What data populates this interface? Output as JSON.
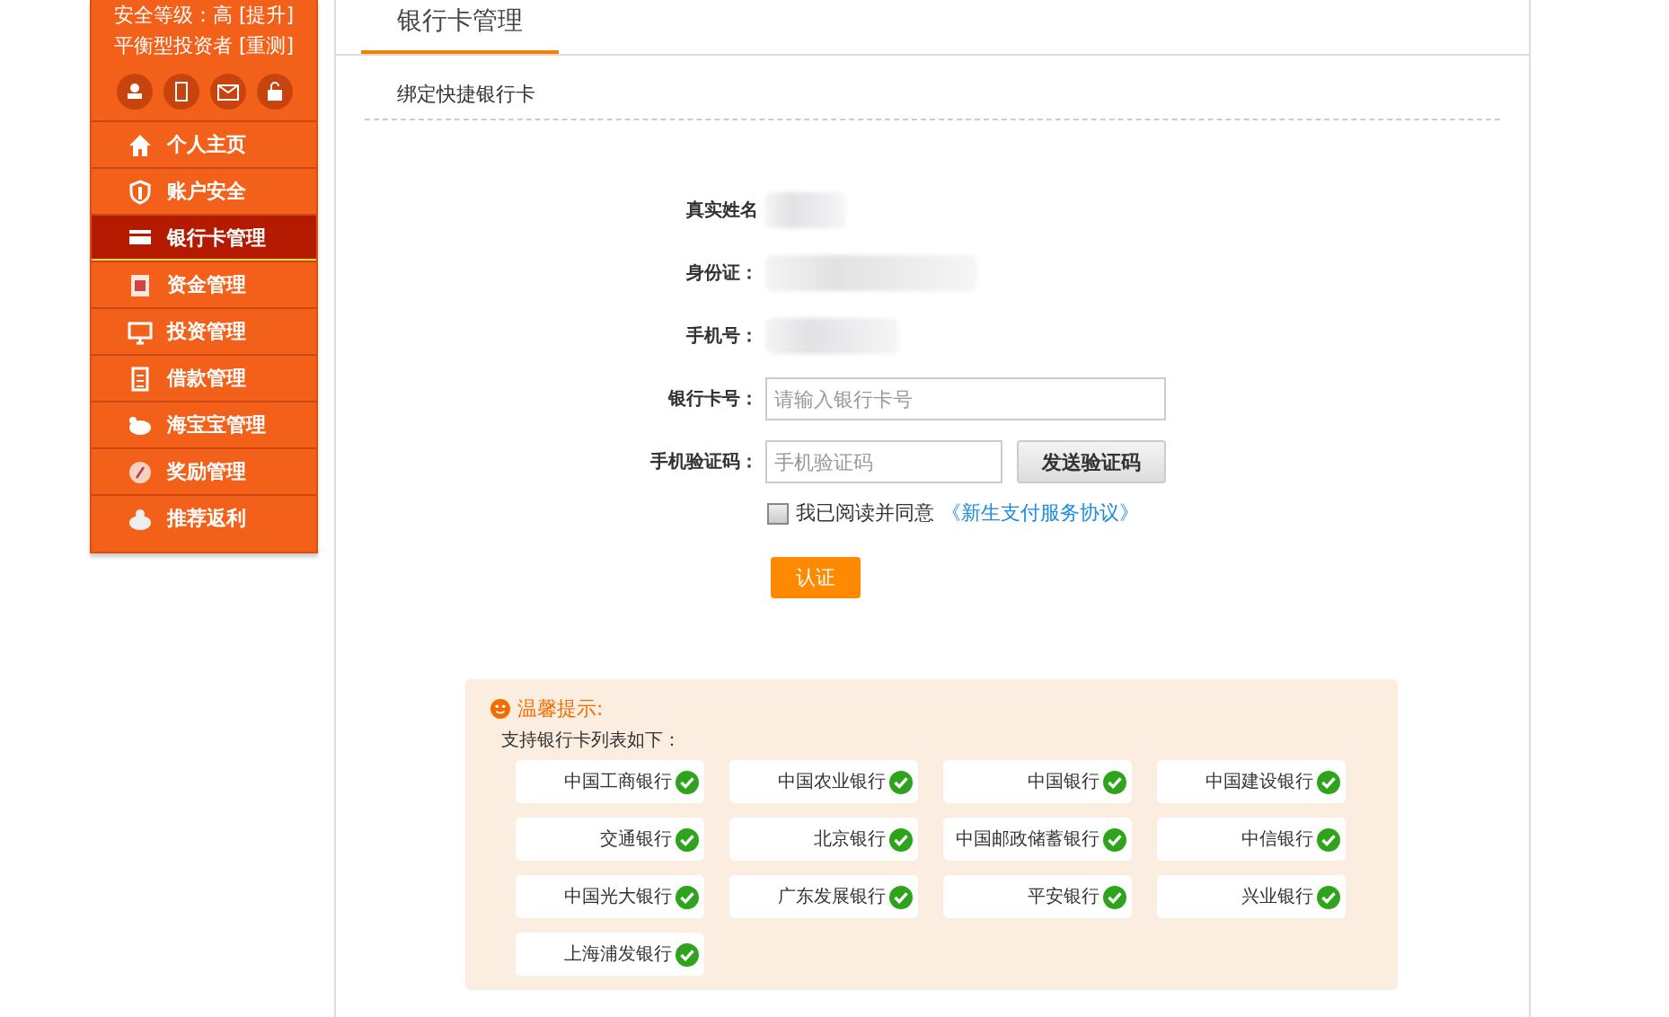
{
  "sidebar": {
    "security_level": "安全等级：高 [提升]",
    "investor_type": "平衡型投资者 [重测]",
    "items": [
      {
        "label": "个人主页",
        "selected": false
      },
      {
        "label": "账户安全",
        "selected": false
      },
      {
        "label": "银行卡管理",
        "selected": true
      },
      {
        "label": "资金管理",
        "selected": false
      },
      {
        "label": "投资管理",
        "selected": false
      },
      {
        "label": "借款管理",
        "selected": false
      },
      {
        "label": "海宝宝管理",
        "selected": false
      },
      {
        "label": "奖励管理",
        "selected": false
      },
      {
        "label": "推荐返利",
        "selected": false
      }
    ]
  },
  "tabs": [
    {
      "label": "银行卡管理",
      "selected": true
    }
  ],
  "section_title": "绑定快捷银行卡",
  "form": {
    "fields": [
      {
        "kind": "static",
        "label": "真实姓名"
      },
      {
        "kind": "static",
        "label": "身份证："
      },
      {
        "kind": "static",
        "label": "手机号："
      },
      {
        "kind": "input",
        "label": "银行卡号：",
        "placeholder": "请输入银行卡号"
      },
      {
        "kind": "code",
        "label": "手机验证码：",
        "placeholder": "手机验证码",
        "button": "发送验证码"
      }
    ],
    "agreement": {
      "checked": false,
      "text": "我已阅读并同意",
      "link": "《新生支付服务协议》"
    },
    "submit": "认证"
  },
  "tips": {
    "title": "温馨提示:",
    "subtitle": "支持银行卡列表如下：",
    "banks": [
      "中国工商银行",
      "中国农业银行",
      "中国银行",
      "中国建设银行",
      "交通银行",
      "北京银行",
      "中国邮政储蓄银行",
      "中信银行",
      "中国光大银行",
      "广东发展银行",
      "平安银行",
      "兴业银行",
      "上海浦发银行"
    ]
  }
}
